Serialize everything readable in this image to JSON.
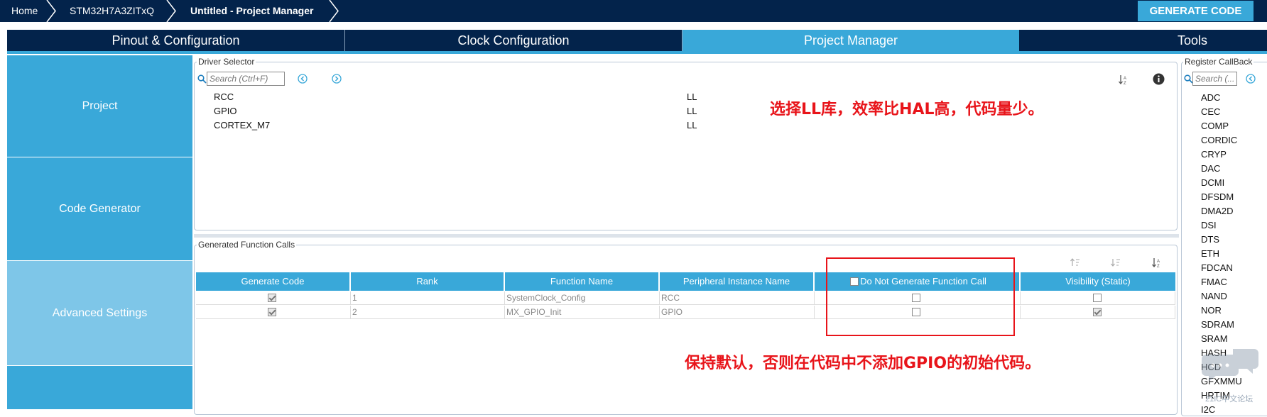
{
  "breadcrumb": {
    "home": "Home",
    "device": "STM32H7A3ZITxQ",
    "project": "Untitled - Project Manager"
  },
  "generate_button": "GENERATE CODE",
  "tabs": [
    {
      "label": "Pinout & Configuration"
    },
    {
      "label": "Clock Configuration"
    },
    {
      "label": "Project Manager"
    },
    {
      "label": "Tools"
    }
  ],
  "sidebar": {
    "items": [
      {
        "label": "Project"
      },
      {
        "label": "Code Generator"
      },
      {
        "label": "Advanced Settings"
      }
    ]
  },
  "driver_selector": {
    "title": "Driver Selector",
    "search_placeholder": "Search (Ctrl+F)",
    "rows": [
      {
        "name": "RCC",
        "driver": "LL"
      },
      {
        "name": "GPIO",
        "driver": "LL"
      },
      {
        "name": "CORTEX_M7",
        "driver": "LL"
      }
    ]
  },
  "function_calls": {
    "title": "Generated Function Calls",
    "headers": [
      "Generate Code",
      "Rank",
      "Function Name",
      "Peripheral Instance Name",
      "Do Not Generate Function Call",
      "Visibility (Static)"
    ],
    "rows": [
      {
        "generate": true,
        "rank": "1",
        "function": "SystemClock_Config",
        "instance": "RCC",
        "do_not_generate": false,
        "visibility": false
      },
      {
        "generate": true,
        "rank": "2",
        "function": "MX_GPIO_Init",
        "instance": "GPIO",
        "do_not_generate": false,
        "visibility": true
      }
    ]
  },
  "register_callback": {
    "title": "Register CallBack",
    "search_placeholder": "Search (...",
    "items": [
      "ADC",
      "CEC",
      "COMP",
      "CORDIC",
      "CRYP",
      "DAC",
      "DCMI",
      "DFSDM",
      "DMA2D",
      "DSI",
      "DTS",
      "ETH",
      "FDCAN",
      "FMAC",
      "NAND",
      "NOR",
      "SDRAM",
      "SRAM",
      "HASH",
      "HCD",
      "GFXMMU",
      "HRTIM",
      "I2C"
    ]
  },
  "annotations": {
    "driver_note": "选择LL库，效率比HAL高，代码量少。",
    "function_note": "保持默认，否则在代码中不添加GPIO的初始代码。"
  },
  "watermark": "21IC中文论坛",
  "colors": {
    "navy": "#03234b",
    "accent": "#39a8d9",
    "active_side": "#7ec6e8",
    "annotation_red": "#e8141a"
  }
}
